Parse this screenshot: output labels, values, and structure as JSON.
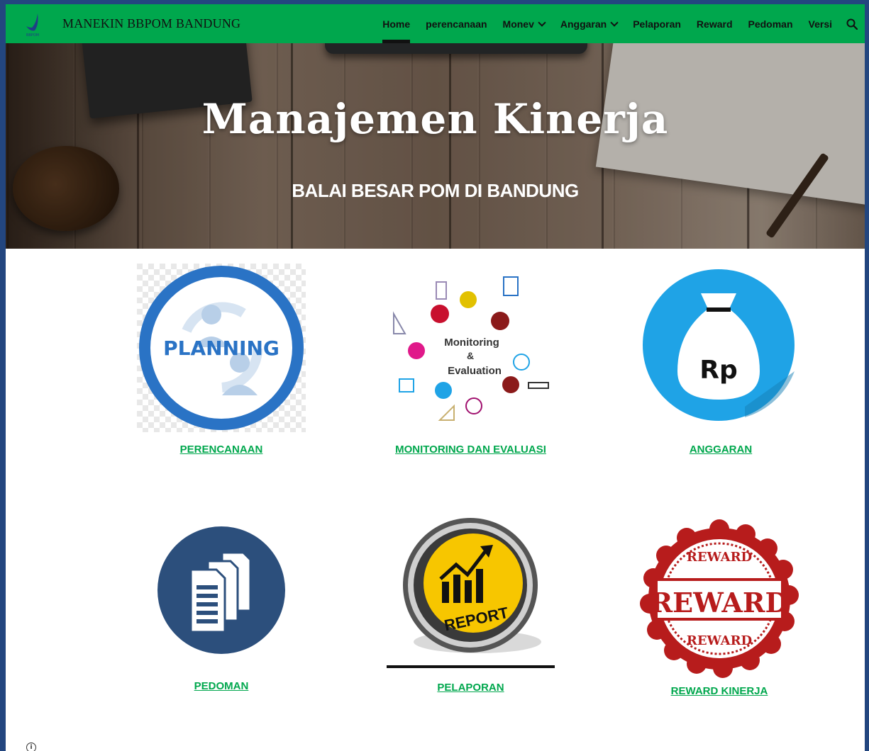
{
  "nav": {
    "site_title": "MANEKIN BBPOM BANDUNG",
    "logo_caption": "BBPOM",
    "items": [
      {
        "label": "Home",
        "active": true,
        "dropdown": false
      },
      {
        "label": "perencanaan",
        "active": false,
        "dropdown": false
      },
      {
        "label": "Monev",
        "active": false,
        "dropdown": true
      },
      {
        "label": "Anggaran",
        "active": false,
        "dropdown": true
      },
      {
        "label": "Pelaporan",
        "active": false,
        "dropdown": false
      },
      {
        "label": "Reward",
        "active": false,
        "dropdown": false
      },
      {
        "label": "Pedoman",
        "active": false,
        "dropdown": false
      },
      {
        "label": "Versi",
        "active": false,
        "dropdown": false
      }
    ],
    "search_icon": "search-icon"
  },
  "hero": {
    "title": "Manajemen Kinerja",
    "subtitle": "BALAI BESAR POM DI BANDUNG"
  },
  "cards": {
    "perencanaan": {
      "label": "PERENCANAAN",
      "image_text": "PLANNING"
    },
    "monev": {
      "label": "MONITORING DAN EVALUASI",
      "image_text_1": "Monitoring",
      "image_text_2": "&",
      "image_text_3": "Evaluation"
    },
    "anggaran": {
      "label": "ANGGARAN",
      "image_text": "Rp"
    },
    "pedoman": {
      "label": "PEDOMAN"
    },
    "pelaporan": {
      "label": "PELAPORAN",
      "image_text": "REPORT"
    },
    "reward": {
      "label": "REWARD KINERJA",
      "image_text_main": "REWARD",
      "image_text_top": "REWARD",
      "image_text_bottom": "REWARD"
    }
  },
  "colors": {
    "accent": "#00a74d",
    "frame": "#23467f",
    "planning_blue": "#2a73c5",
    "money_blue": "#1fa3e6",
    "doc_blue": "#2c4f7c",
    "report_yellow": "#f7c600",
    "reward_red": "#b71c1c"
  },
  "footer": {
    "info_icon": "info-icon"
  }
}
